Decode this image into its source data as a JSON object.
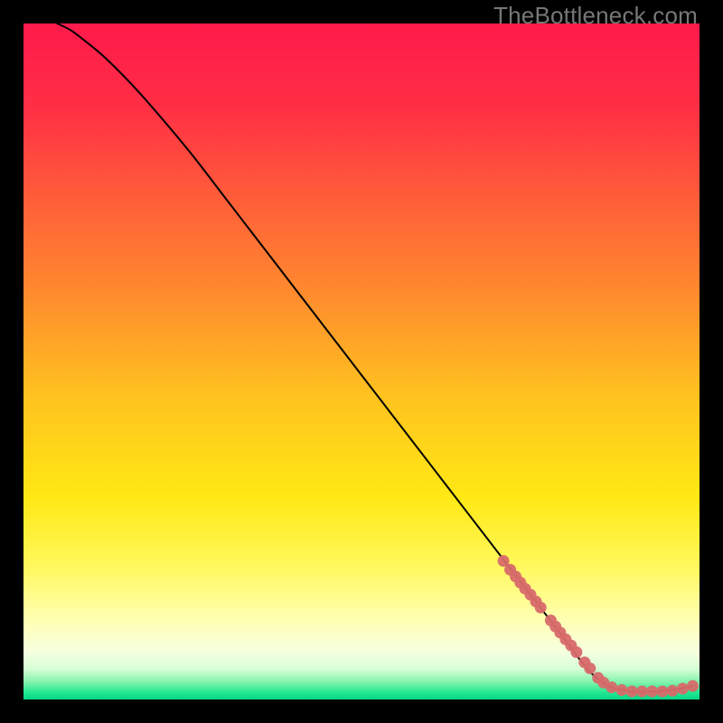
{
  "watermark": "TheBottleneck.com",
  "chart_data": {
    "type": "line",
    "title": "",
    "xlabel": "",
    "ylabel": "",
    "xlim": [
      0,
      100
    ],
    "ylim": [
      0,
      100
    ],
    "grid": false,
    "legend": false,
    "background_gradient": {
      "stops": [
        {
          "offset": 0.0,
          "color": "#ff1a4b"
        },
        {
          "offset": 0.12,
          "color": "#ff2e45"
        },
        {
          "offset": 0.25,
          "color": "#ff5a3a"
        },
        {
          "offset": 0.4,
          "color": "#ff8b2e"
        },
        {
          "offset": 0.55,
          "color": "#ffc21f"
        },
        {
          "offset": 0.7,
          "color": "#ffe814"
        },
        {
          "offset": 0.8,
          "color": "#fff85a"
        },
        {
          "offset": 0.88,
          "color": "#ffffb0"
        },
        {
          "offset": 0.93,
          "color": "#f6ffe0"
        },
        {
          "offset": 0.955,
          "color": "#d6ffd6"
        },
        {
          "offset": 0.975,
          "color": "#7ff2aa"
        },
        {
          "offset": 0.99,
          "color": "#20e890"
        },
        {
          "offset": 1.0,
          "color": "#06d488"
        }
      ]
    },
    "series": [
      {
        "name": "curve",
        "kind": "line",
        "color": "#000000",
        "x": [
          5,
          7,
          9,
          12,
          16,
          20,
          25,
          30,
          35,
          40,
          45,
          50,
          55,
          60,
          65,
          70,
          75,
          80,
          83,
          85,
          87,
          90,
          93,
          96,
          99
        ],
        "y": [
          100,
          99,
          97.5,
          95,
          91,
          86.5,
          80.5,
          74,
          67.5,
          61,
          54.5,
          48,
          41.5,
          35,
          28.5,
          22,
          15.5,
          9,
          5,
          3,
          1.8,
          1.2,
          1.2,
          1.4,
          2.0
        ]
      },
      {
        "name": "points",
        "kind": "scatter",
        "color": "#d86a6a",
        "x": [
          71,
          72,
          72.8,
          73.5,
          74.2,
          75,
          75.8,
          76.5,
          78,
          78.7,
          79.4,
          80.2,
          81,
          81.8,
          83,
          83.8,
          85,
          85.8,
          87,
          88.5,
          90,
          91.5,
          93,
          94.5,
          96,
          97.5,
          99
        ],
        "y": [
          20.5,
          19.2,
          18.2,
          17.3,
          16.4,
          15.5,
          14.5,
          13.6,
          11.7,
          10.8,
          9.9,
          8.9,
          8.0,
          7.0,
          5.5,
          4.6,
          3.2,
          2.5,
          1.8,
          1.4,
          1.2,
          1.2,
          1.2,
          1.2,
          1.3,
          1.6,
          2.0
        ]
      }
    ]
  }
}
